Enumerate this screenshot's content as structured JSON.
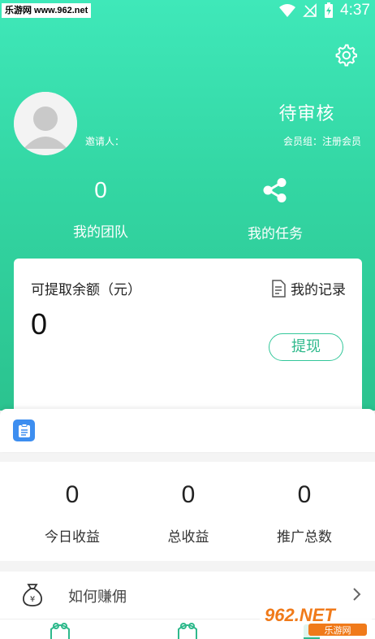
{
  "watermark": {
    "top_text": "乐游网 www.962.net",
    "bottom_brand": "962.NET",
    "bottom_sub": "乐游网"
  },
  "status_bar": {
    "time": "4:37"
  },
  "profile": {
    "inviter_label": "邀请人：",
    "status": "待审核",
    "member_group": "会员组：注册会员"
  },
  "quick_stats": {
    "team_count": "0",
    "team_label": "我的团队",
    "task_label": "我的任务"
  },
  "balance": {
    "title": "可提取余额（元）",
    "records_label": "我的记录",
    "amount": "0",
    "withdraw_label": "提现"
  },
  "earnings": [
    {
      "value": "0",
      "label": "今日收益"
    },
    {
      "value": "0",
      "label": "总收益"
    },
    {
      "value": "0",
      "label": "推广总数"
    }
  ],
  "how_to_earn": {
    "label": "如何赚佣"
  },
  "colors": {
    "accent": "#33d6a3",
    "accent_dark": "#2bc38f",
    "button_text": "#2fb98c",
    "notice_icon": "#3d8ef0"
  },
  "icons": {
    "settings": "gear-icon",
    "share": "share-icon",
    "records": "document-icon",
    "notice": "clipboard-icon",
    "earn": "money-bag-icon",
    "chevron": "chevron-right-icon"
  }
}
